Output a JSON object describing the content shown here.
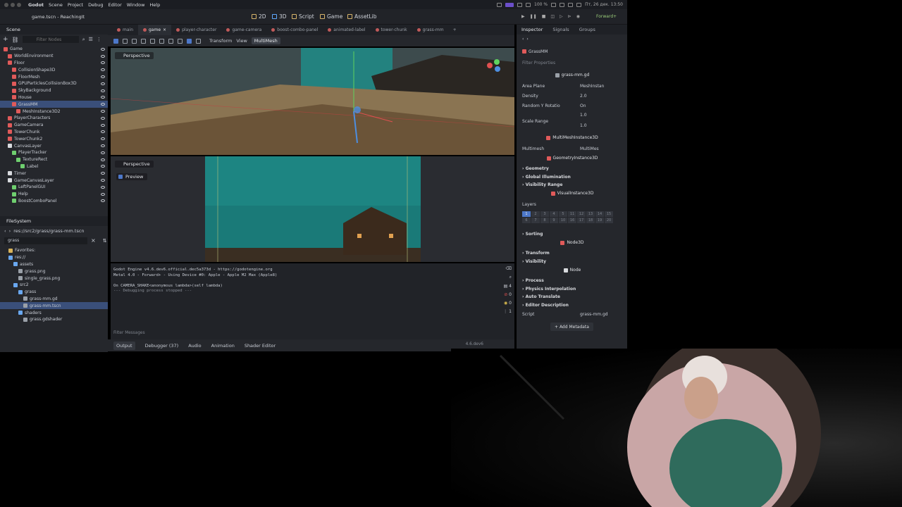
{
  "menubar": {
    "app": "Godot",
    "items": [
      "Scene",
      "Project",
      "Debug",
      "Editor",
      "Window",
      "Help"
    ],
    "battery": "100 %",
    "datetime": "Пт, 26 дек. 13:50"
  },
  "titlebar": {
    "title": "game.tscn - ReachingIt",
    "main_screens": [
      "2D",
      "3D",
      "Script",
      "Game",
      "AssetLib"
    ],
    "renderer": "Forward+"
  },
  "scene": {
    "tabs": [
      "Scene",
      "Import"
    ],
    "filter_placeholder": "Filter Nodes",
    "nodes": [
      {
        "label": "Game",
        "indent": 0,
        "icon": "red"
      },
      {
        "label": "WorldEnvironment",
        "indent": 1,
        "icon": "red"
      },
      {
        "label": "Floor",
        "indent": 1,
        "icon": "red"
      },
      {
        "label": "CollisionShape3D",
        "indent": 2,
        "icon": "red"
      },
      {
        "label": "FloorMesh",
        "indent": 2,
        "icon": "red"
      },
      {
        "label": "GPUParticlesCollisionBox3D",
        "indent": 2,
        "icon": "red"
      },
      {
        "label": "SkyBackground",
        "indent": 2,
        "icon": "red"
      },
      {
        "label": "House",
        "indent": 2,
        "icon": "red"
      },
      {
        "label": "GrassMM",
        "indent": 2,
        "icon": "red",
        "selected": true
      },
      {
        "label": "MeshInstance3D2",
        "indent": 3,
        "icon": "red"
      },
      {
        "label": "PlayerCharacters",
        "indent": 1,
        "icon": "red"
      },
      {
        "label": "GameCamera",
        "indent": 1,
        "icon": "red"
      },
      {
        "label": "TowerChunk",
        "indent": 1,
        "icon": "red"
      },
      {
        "label": "TowerChunk2",
        "indent": 1,
        "icon": "red"
      },
      {
        "label": "CanvasLayer",
        "indent": 1,
        "icon": "white"
      },
      {
        "label": "PlayerTracker",
        "indent": 2,
        "icon": "green"
      },
      {
        "label": "TextureRect",
        "indent": 3,
        "icon": "green"
      },
      {
        "label": "Label",
        "indent": 4,
        "icon": "green"
      },
      {
        "label": "Timer",
        "indent": 1,
        "icon": "white"
      },
      {
        "label": "GameCanvasLayer",
        "indent": 1,
        "icon": "white"
      },
      {
        "label": "LeftPanelGUI",
        "indent": 2,
        "icon": "green"
      },
      {
        "label": "Help",
        "indent": 2,
        "icon": "green"
      },
      {
        "label": "BoostComboPanel",
        "indent": 2,
        "icon": "green"
      }
    ]
  },
  "filesystem": {
    "title": "FileSystem",
    "path": "res://src2/grass/grass-mm.tscn",
    "search": "grass",
    "items": [
      {
        "label": "Favorites:",
        "indent": 0,
        "icon": "yellow"
      },
      {
        "label": "res://",
        "indent": 0,
        "icon": "blue"
      },
      {
        "label": "assets",
        "indent": 1,
        "icon": "blue"
      },
      {
        "label": "grass.png",
        "indent": 2,
        "icon": "grey"
      },
      {
        "label": "single_grass.png",
        "indent": 2,
        "icon": "grey"
      },
      {
        "label": "src2",
        "indent": 1,
        "icon": "blue"
      },
      {
        "label": "grass",
        "indent": 2,
        "icon": "blue"
      },
      {
        "label": "grass-mm.gd",
        "indent": 3,
        "icon": "grey"
      },
      {
        "label": "grass-mm.tscn",
        "indent": 3,
        "icon": "grey",
        "selected": true
      },
      {
        "label": "shaders",
        "indent": 2,
        "icon": "blue"
      },
      {
        "label": "grass.gdshader",
        "indent": 3,
        "icon": "grey"
      }
    ]
  },
  "editor_tabs": [
    "main",
    "game",
    "player-character",
    "game-camera",
    "boost-combo-panel",
    "animated-label",
    "tower-chunk",
    "grass-mm"
  ],
  "viewport": {
    "toolbar": {
      "transform": "Transform",
      "view": "View",
      "multimesh": "MultiMesh"
    },
    "top_label": "Perspective",
    "bottom_label": "Perspective",
    "preview": "Preview"
  },
  "output": {
    "lines": [
      "Godot Engine v4.6.dev6.official.dec5a373d - https://godotengine.org",
      "Metal 4.0 - Forward+ - Using Device #0: Apple - Apple M2 Max (Apple8)",
      "",
      "On CAMERA_SHAKE<anonymous lambda>(self lambda)",
      "--- Debugging process stopped ---"
    ],
    "filter_placeholder": "Filter Messages",
    "counts": [
      "4",
      "0",
      "0",
      "1"
    ],
    "bottom_tabs": [
      "Output",
      "Debugger (37)",
      "Audio",
      "Animation",
      "Shader Editor"
    ],
    "version": "4.6.dev6"
  },
  "inspector": {
    "tabs": [
      "Inspector",
      "Signals",
      "Groups"
    ],
    "node_name": "GrassMM",
    "filter_placeholder": "Filter Properties",
    "script_name": "grass-mm.gd",
    "props": {
      "area_plane": "Area Plane",
      "area_plane_val": "MeshInstan",
      "density": "Density",
      "density_val": "2.0",
      "random_y": "Random Y Rotatio",
      "random_y_val": "On",
      "scale_range": "Scale Range",
      "scale_x": "1.0",
      "scale_y": "1.0"
    },
    "class_multimesh": "MultiMeshInstance3D",
    "multimesh": "Multimesh",
    "multimesh_val": "MultiMes",
    "class_geometry": "GeometryInstance3D",
    "geometry_sections": [
      "Geometry",
      "Global Illumination",
      "Visibility Range"
    ],
    "class_visual": "VisualInstance3D",
    "layers": "Layers",
    "layer_numbers": [
      "1",
      "2",
      "3",
      "4",
      "5",
      "11",
      "12",
      "13",
      "14",
      "15",
      "6",
      "7",
      "8",
      "9",
      "10",
      "16",
      "17",
      "18",
      "19",
      "20"
    ],
    "sorting": "Sorting",
    "class_node3d": "Node3D",
    "node3d_sections": [
      "Transform",
      "Visibility"
    ],
    "class_node": "Node",
    "node_sections": [
      "Process",
      "Physics Interpolation",
      "Auto Translate",
      "Editor Description"
    ],
    "script_label": "Script",
    "script_val": "grass-mm.gd",
    "add_metadata": "Add Metadata"
  },
  "colors": {
    "accent": "#4d78c9",
    "node3d": "#e05a5a",
    "control": "#6fcf6f",
    "teal_sky": "#1f8c88"
  }
}
